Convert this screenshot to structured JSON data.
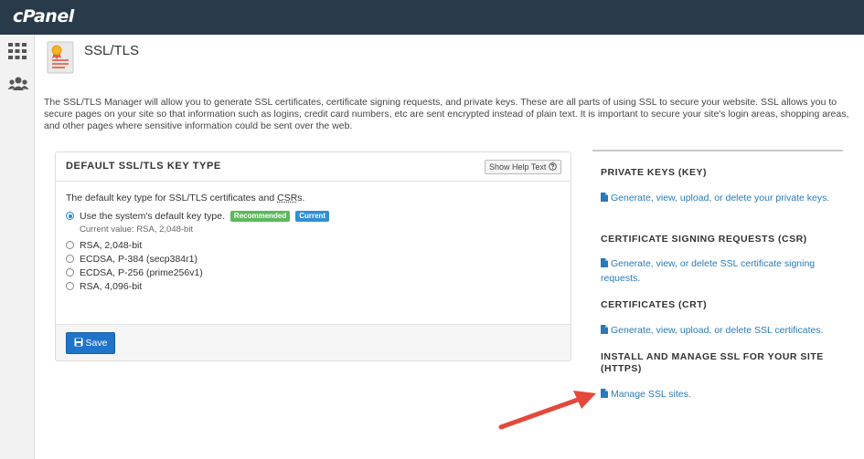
{
  "app": {
    "logo": "cPanel"
  },
  "sidebar": {
    "items": [
      {
        "icon": "grid-icon"
      },
      {
        "icon": "users-icon"
      }
    ]
  },
  "page": {
    "title": "SSL/TLS",
    "intro": "The SSL/TLS Manager will allow you to generate SSL certificates, certificate signing requests, and private keys. These are all parts of using SSL to secure your website. SSL allows you to secure pages on your site so that information such as logins, credit card numbers, etc are sent encrypted instead of plain text. It is important to secure your site's login areas, shopping areas, and other pages where sensitive information could be sent over the web."
  },
  "key_type_panel": {
    "title": "DEFAULT SSL/TLS KEY TYPE",
    "help_button": "Show Help Text",
    "description_prefix": "The default key type for SSL/TLS certificates and ",
    "description_abbr": "CSR",
    "description_suffix": "s.",
    "options": [
      {
        "label": "Use the system's default key type.",
        "checked": true,
        "badges": [
          "Recommended",
          "Current"
        ]
      },
      {
        "label": "RSA, 2,048-bit",
        "checked": false
      },
      {
        "label": "ECDSA, P-384 (secp384r1)",
        "checked": false
      },
      {
        "label": "ECDSA, P-256 (prime256v1)",
        "checked": false
      },
      {
        "label": "RSA, 4,096-bit",
        "checked": false
      }
    ],
    "badge_recommended": "Recommended",
    "badge_current": "Current",
    "current_value": "Current value: RSA, 2,048-bit",
    "save_label": "Save"
  },
  "right_sections": [
    {
      "title": "PRIVATE KEYS (KEY)",
      "link": "Generate, view, upload, or delete your private keys."
    },
    {
      "title": "CERTIFICATE SIGNING REQUESTS (CSR)",
      "link": "Generate, view, or delete SSL certificate signing requests."
    },
    {
      "title": "CERTIFICATES (CRT)",
      "link": "Generate, view, upload, or delete SSL certificates."
    },
    {
      "title": "INSTALL AND MANAGE SSL FOR YOUR SITE (HTTPS)",
      "link": "Manage SSL sites."
    }
  ],
  "colors": {
    "topbar": "#293a4a",
    "link": "#2a7ab8",
    "primary_button": "#1f74c9",
    "badge_recommended": "#5cb85c",
    "badge_current": "#2f8fd8",
    "annotation_arrow": "#e5483a"
  }
}
